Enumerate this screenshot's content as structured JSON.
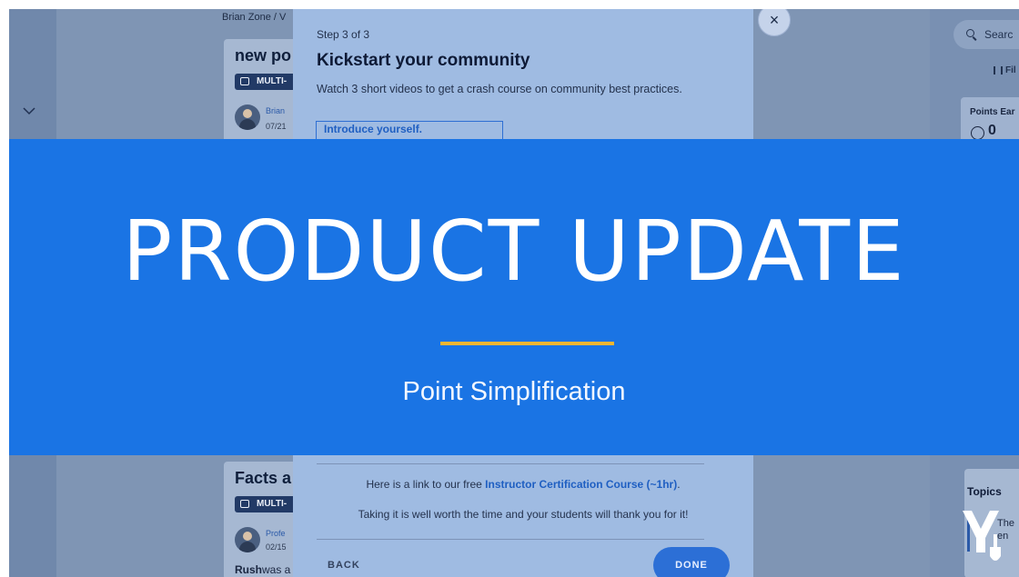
{
  "breadcrumb": {
    "root": "Brian Zone",
    "sep": "/",
    "next": "V"
  },
  "feed": {
    "post1": {
      "title": "new po",
      "tag": "MULTI-",
      "author": "Brian",
      "date": "07/21"
    },
    "post2": {
      "title": "Facts a",
      "tag": "MULTI-",
      "author": "Profe",
      "date": "02/15",
      "excerpt_bold": "Rush",
      "excerpt": "was a"
    }
  },
  "modal": {
    "step": "Step 3 of 3",
    "title": "Kickstart your community",
    "subtitle": "Watch 3 short videos to get a crash course on community best practices.",
    "video_link": "Introduce yourself.",
    "link_prefix": "Here is a link to our free",
    "link_text": "Instructor Certification Course (~1hr)",
    "link_suffix": ".",
    "thanks": "Taking it is well worth the time and your students will thank you for it!",
    "back_label": "BACK",
    "done_label": "DONE",
    "close_glyph": "×"
  },
  "sidebar": {
    "search_placeholder": "Searc",
    "filter_label": "Fil",
    "points_label": "Points Ear",
    "points_value": "0",
    "topics_title": "Topics",
    "topics_item_1": "The",
    "topics_item_2": "en"
  },
  "banner": {
    "title": "PRODUCT UPDATE",
    "subtitle": "Point Simplification",
    "rule_color": "#f2b631",
    "background": "#1a74e4"
  },
  "icons": [
    "chevron-down-icon",
    "close-icon",
    "search-icon",
    "filter-icon",
    "clock-icon",
    "chat-icon",
    "brand-logo-icon"
  ]
}
